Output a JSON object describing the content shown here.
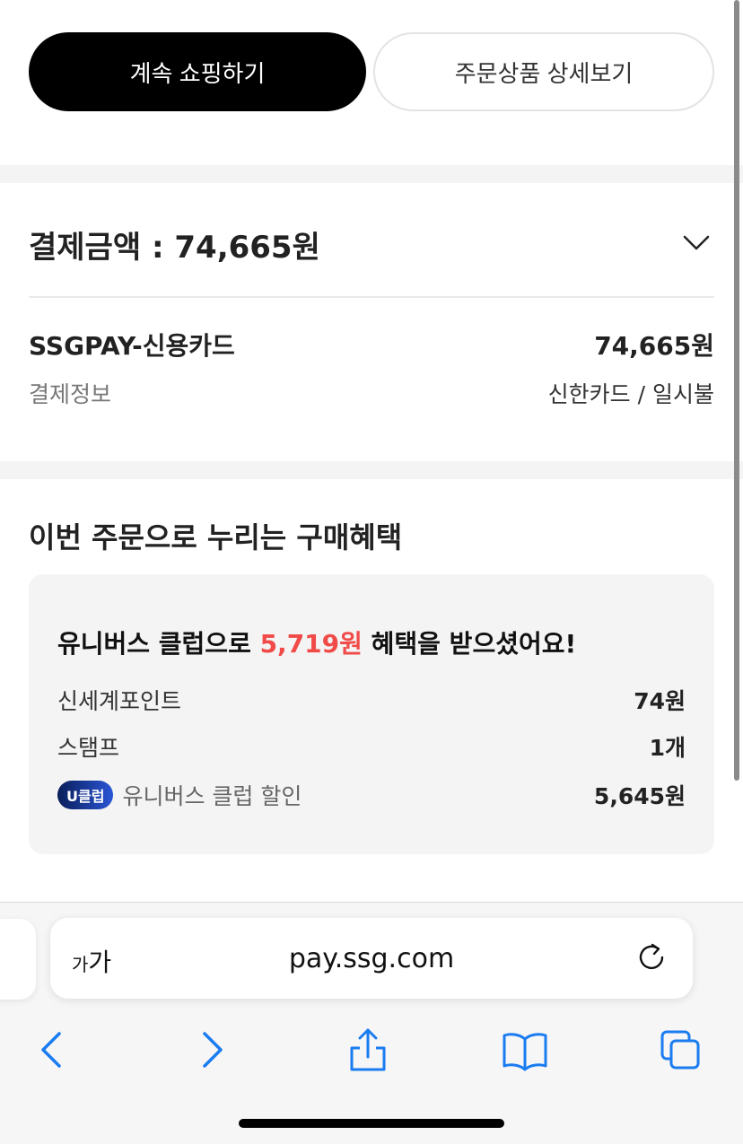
{
  "top_buttons": {
    "continue_shopping": "계속 쇼핑하기",
    "order_details": "주문상품 상세보기"
  },
  "payment": {
    "title": "결제금액 : 74,665원",
    "method": "SSGPAY-신용카드",
    "amount": "74,665원",
    "info_label": "결제정보",
    "info_value": "신한카드 / 일시불"
  },
  "benefits": {
    "title": "이번 주문으로 누리는 구매혜택",
    "headline_prefix": "유니버스 클럽으로 ",
    "headline_amount": "5,719원",
    "headline_suffix": " 혜택을 받으셨어요!",
    "rows": [
      {
        "label": "신세계포인트",
        "value": "74원"
      },
      {
        "label": "스탬프",
        "value": "1개"
      },
      {
        "badge": "U클럽",
        "label": "유니버스 클럽 할인",
        "value": "5,645원"
      }
    ]
  },
  "browser": {
    "text_size_small": "가",
    "text_size_large": "가",
    "url": "pay.ssg.com"
  },
  "colors": {
    "accent": "#f04b48",
    "ios_blue": "#1a7cf0",
    "primary_button": "#000000"
  }
}
